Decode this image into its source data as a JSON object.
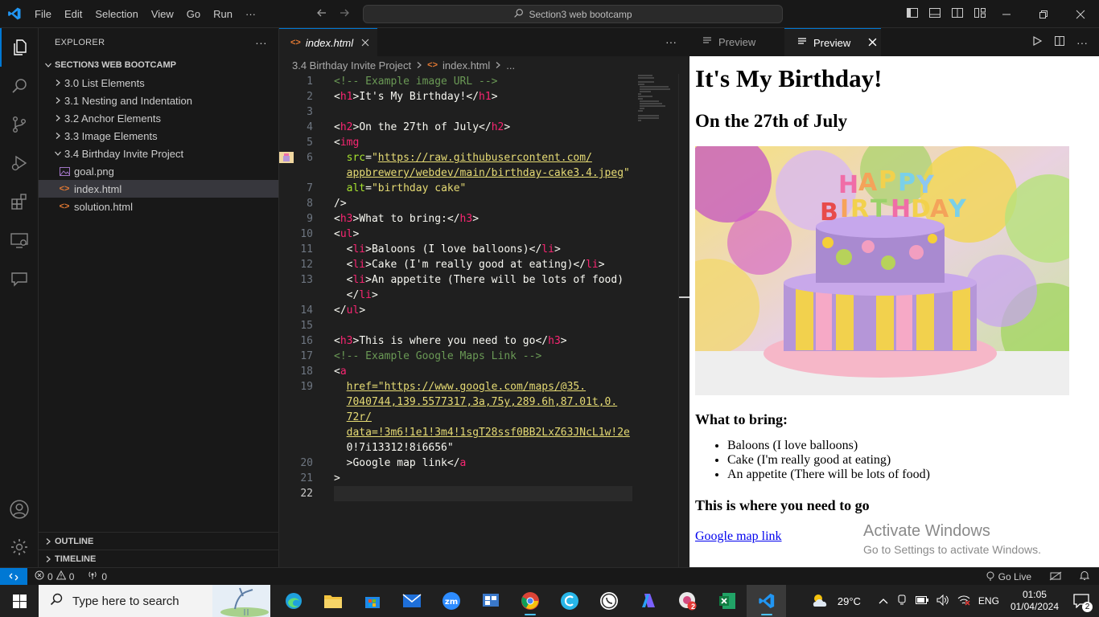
{
  "titlebar": {
    "menu": [
      "File",
      "Edit",
      "Selection",
      "View",
      "Go",
      "Run"
    ],
    "more": "···",
    "search_text": "Section3 web bootcamp"
  },
  "sidebar": {
    "title": "EXPLORER",
    "more": "···",
    "root": "SECTION3 WEB BOOTCAMP",
    "folders": [
      {
        "label": "3.0 List Elements"
      },
      {
        "label": "3.1 Nesting and Indentation"
      },
      {
        "label": "3.2 Anchor Elements"
      },
      {
        "label": "3.3 Image Elements"
      }
    ],
    "open_folder": "3.4 Birthday Invite Project",
    "files": [
      {
        "label": "goal.png",
        "type": "image"
      },
      {
        "label": "index.html",
        "type": "html",
        "selected": true
      },
      {
        "label": "solution.html",
        "type": "html"
      }
    ],
    "outline": "OUTLINE",
    "timeline": "TIMELINE"
  },
  "editor": {
    "tab_label": "index.html",
    "more": "···",
    "breadcrumb": {
      "folder": "3.4 Birthday Invite Project",
      "file": "index.html",
      "tail": "..."
    },
    "lines": [
      {
        "n": "1",
        "text": "<!-- Example image URL -->"
      },
      {
        "n": "2",
        "text": "<h1>It's My Birthday!</h1>"
      },
      {
        "n": "3",
        "text": ""
      },
      {
        "n": "4",
        "text": "<h2>On the 27th of July</h2>"
      },
      {
        "n": "5",
        "text": "<img"
      },
      {
        "n": "6",
        "text": "  src=\"https://raw.githubusercontent.com/"
      },
      {
        "n": "",
        "text": "  appbrewery/webdev/main/birthday-cake3.4.jpeg\""
      },
      {
        "n": "7",
        "text": "  alt=\"birthday cake\""
      },
      {
        "n": "8",
        "text": "/>"
      },
      {
        "n": "9",
        "text": "<h3>What to bring:</h3>"
      },
      {
        "n": "10",
        "text": "<ul>"
      },
      {
        "n": "11",
        "text": "  <li>Baloons (I love balloons)</li>"
      },
      {
        "n": "12",
        "text": "  <li>Cake (I'm really good at eating)</li>"
      },
      {
        "n": "13",
        "text": "  <li>An appetite (There will be lots of food)"
      },
      {
        "n": "",
        "text": "  </li>"
      },
      {
        "n": "14",
        "text": "</ul>"
      },
      {
        "n": "15",
        "text": ""
      },
      {
        "n": "16",
        "text": "<h3>This is where you need to go</h3>"
      },
      {
        "n": "17",
        "text": "<!-- Example Google Maps Link -->"
      },
      {
        "n": "18",
        "text": "<a"
      },
      {
        "n": "19",
        "text": "  href=\"https://www.google.com/maps/@35."
      },
      {
        "n": "",
        "text": "  7040744,139.5577317,3a,75y,289.6h,87.01t,0."
      },
      {
        "n": "",
        "text": "  72r/"
      },
      {
        "n": "",
        "text": "  data=!3m6!1e1!3m4!1sgT28ssf0BB2LxZ63JNcL1w!2e"
      },
      {
        "n": "",
        "text": "  0!7i13312!8i6656\""
      },
      {
        "n": "20",
        "text": "  >Google map link</a"
      },
      {
        "n": "21",
        "text": ">"
      },
      {
        "n": "22",
        "text": ""
      }
    ]
  },
  "preview": {
    "tab_inactive": "Preview",
    "tab_active": "Preview",
    "h1": "It's My Birthday!",
    "h2": "On the 27th of July",
    "h3_bring": "What to bring:",
    "items": [
      "Baloons (I love balloons)",
      "Cake (I'm really good at eating)",
      "An appetite (There will be lots of food)"
    ],
    "h3_go": "This is where you need to go",
    "link": "Google map link",
    "activate_title": "Activate Windows",
    "activate_sub": "Go to Settings to activate Windows."
  },
  "statusbar": {
    "errors": "0",
    "warnings": "0",
    "ports": "0",
    "golive": "Go Live"
  },
  "taskbar": {
    "search_placeholder": "Type here to search",
    "temperature": "29°C",
    "language": "ENG",
    "time": "01:05",
    "date": "01/04/2024",
    "notifications": "2",
    "chrome_badge": "2"
  },
  "colors": {
    "accent": "#0078d4",
    "editor_bg": "#1f1f1f",
    "chrome_bg": "#181818"
  }
}
